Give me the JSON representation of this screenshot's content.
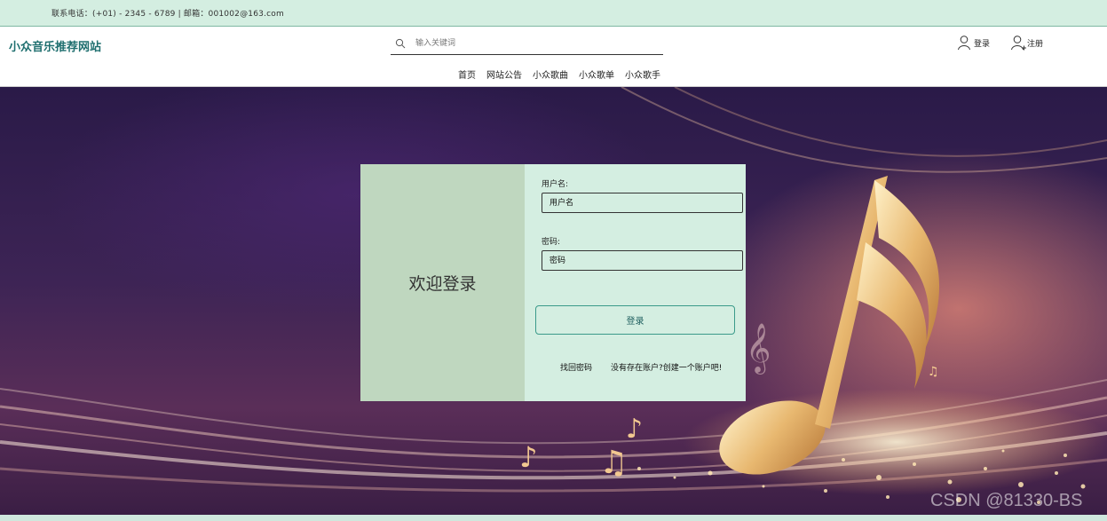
{
  "topbar": {
    "contact": "联系电话：(+01) - 2345 - 6789 | 邮箱：001002@163.com"
  },
  "header": {
    "site_title": "小众音乐推荐网站",
    "search": {
      "placeholder": "输入关键词",
      "value": ""
    },
    "login_label": "登录",
    "register_label": "注册"
  },
  "nav": {
    "items": [
      {
        "label": "首页"
      },
      {
        "label": "网站公告"
      },
      {
        "label": "小众歌曲"
      },
      {
        "label": "小众歌单"
      },
      {
        "label": "小众歌手"
      }
    ]
  },
  "login_card": {
    "welcome": "欢迎登录",
    "username_label": "用户名:",
    "username_placeholder": "用户名",
    "password_label": "密码:",
    "password_placeholder": "密码",
    "submit_label": "登录",
    "forgot_link": "找回密码",
    "signup_link": "没有存在账户?创建一个账户吧!"
  },
  "watermark": "CSDN @81330-BS",
  "colors": {
    "accent": "#1f6f6f",
    "panel": "#d4eee1",
    "welcome_panel": "#bfd7bf",
    "hero_dark": "#2a1a48"
  }
}
